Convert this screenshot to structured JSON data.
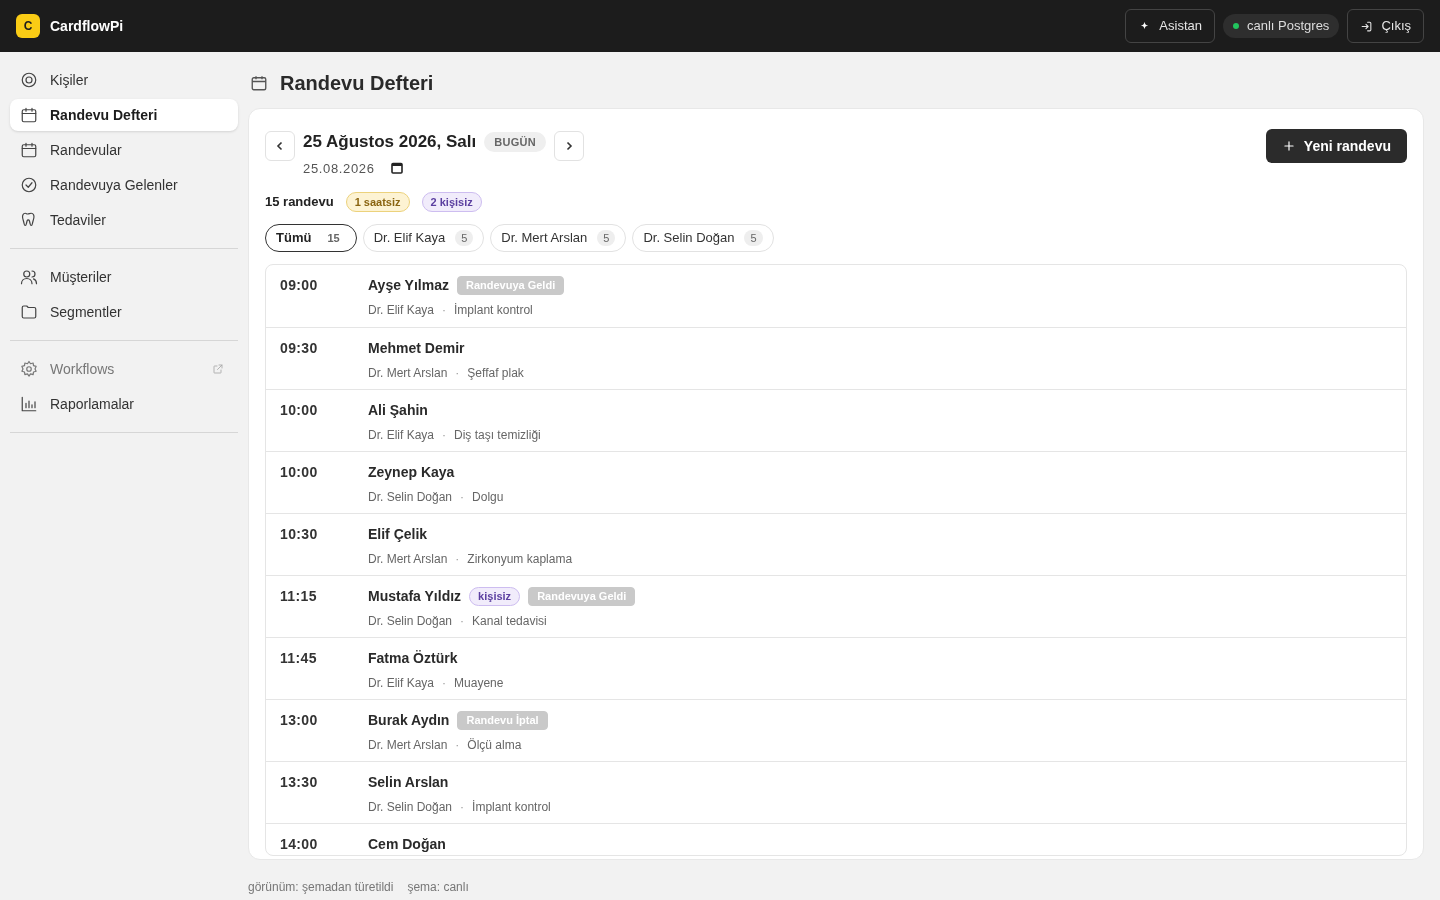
{
  "app": {
    "logo_letter": "C",
    "name": "CardflowPi"
  },
  "header_actions": [
    {
      "kind": "button",
      "label": "Asistan"
    },
    {
      "kind": "status",
      "label": "canlı Postgres",
      "color": "#22c55e"
    },
    {
      "kind": "button",
      "label": "Çıkış"
    }
  ],
  "sidebar": {
    "groups": [
      {
        "items": [
          {
            "label": "Kişiler",
            "selected": false
          },
          {
            "label": "Randevu Defteri",
            "selected": true
          },
          {
            "label": "Randevular",
            "selected": false
          },
          {
            "label": "Randevuya Gelenler",
            "selected": false
          },
          {
            "label": "Tedaviler",
            "selected": false
          }
        ]
      },
      {
        "items": [
          {
            "label": "Müşteriler",
            "selected": false
          },
          {
            "label": "Segmentler",
            "selected": false
          }
        ]
      },
      {
        "items": [
          {
            "label": "Workflows",
            "selected": false,
            "external": true
          },
          {
            "label": "Raporlamalar",
            "selected": false
          }
        ]
      }
    ]
  },
  "page": {
    "title": "Randevu Defteri"
  },
  "date_nav": {
    "date_title": "25 Ağustos 2026, Salı",
    "today_badge": "BUGÜN",
    "date_value": "25.08.2026",
    "new_button": "Yeni randevu"
  },
  "summary": {
    "count": "15 randevu",
    "badges": [
      {
        "kind": "amber",
        "label": "1 saatsiz"
      },
      {
        "kind": "purple",
        "label": "2 kişisiz"
      }
    ]
  },
  "filters": [
    {
      "label": "Tümü",
      "count": "15",
      "selected": true
    },
    {
      "label": "Dr. Elif Kaya",
      "count": "5",
      "selected": false
    },
    {
      "label": "Dr. Mert Arslan",
      "count": "5",
      "selected": false
    },
    {
      "label": "Dr. Selin Doğan",
      "count": "5",
      "selected": false
    }
  ],
  "appointments": [
    {
      "time": "09:00",
      "name": "Ayşe Yılmaz",
      "doctor": "Dr. Elif Kaya",
      "separator": "·",
      "treatment": "İmplant kontrol",
      "tags": [
        {
          "kind": "status",
          "label": "Randevuya Geldi"
        }
      ]
    },
    {
      "time": "09:30",
      "name": "Mehmet Demir",
      "doctor": "Dr. Mert Arslan",
      "separator": "·",
      "treatment": "Şeffaf plak"
    },
    {
      "time": "10:00",
      "name": "Ali Şahin",
      "doctor": "Dr. Elif Kaya",
      "separator": "·",
      "treatment": "Diş taşı temizliği"
    },
    {
      "time": "10:00",
      "name": "Zeynep Kaya",
      "doctor": "Dr. Selin Doğan",
      "separator": "·",
      "treatment": "Dolgu"
    },
    {
      "time": "10:30",
      "name": "Elif Çelik",
      "doctor": "Dr. Mert Arslan",
      "separator": "·",
      "treatment": "Zirkonyum kaplama"
    },
    {
      "time": "11:15",
      "name": "Mustafa Yıldız",
      "doctor": "Dr. Selin Doğan",
      "separator": "·",
      "treatment": "Kanal tedavisi",
      "tags": [
        {
          "kind": "persona",
          "label": "kişisiz"
        },
        {
          "kind": "status",
          "label": "Randevuya Geldi"
        }
      ]
    },
    {
      "time": "11:45",
      "name": "Fatma Öztürk",
      "doctor": "Dr. Elif Kaya",
      "separator": "·",
      "treatment": "Muayene"
    },
    {
      "time": "13:00",
      "name": "Burak Aydın",
      "doctor": "Dr. Mert Arslan",
      "separator": "·",
      "treatment": "Ölçü alma",
      "tags": [
        {
          "kind": "status",
          "label": "Randevu İptal"
        }
      ]
    },
    {
      "time": "13:30",
      "name": "Selin Arslan",
      "doctor": "Dr. Selin Doğan",
      "separator": "·",
      "treatment": "İmplant kontrol"
    },
    {
      "time": "14:00",
      "name": "Cem Doğan"
    }
  ],
  "footer": [
    "görünüm: şemadan türetildi",
    "şema: canlı"
  ]
}
